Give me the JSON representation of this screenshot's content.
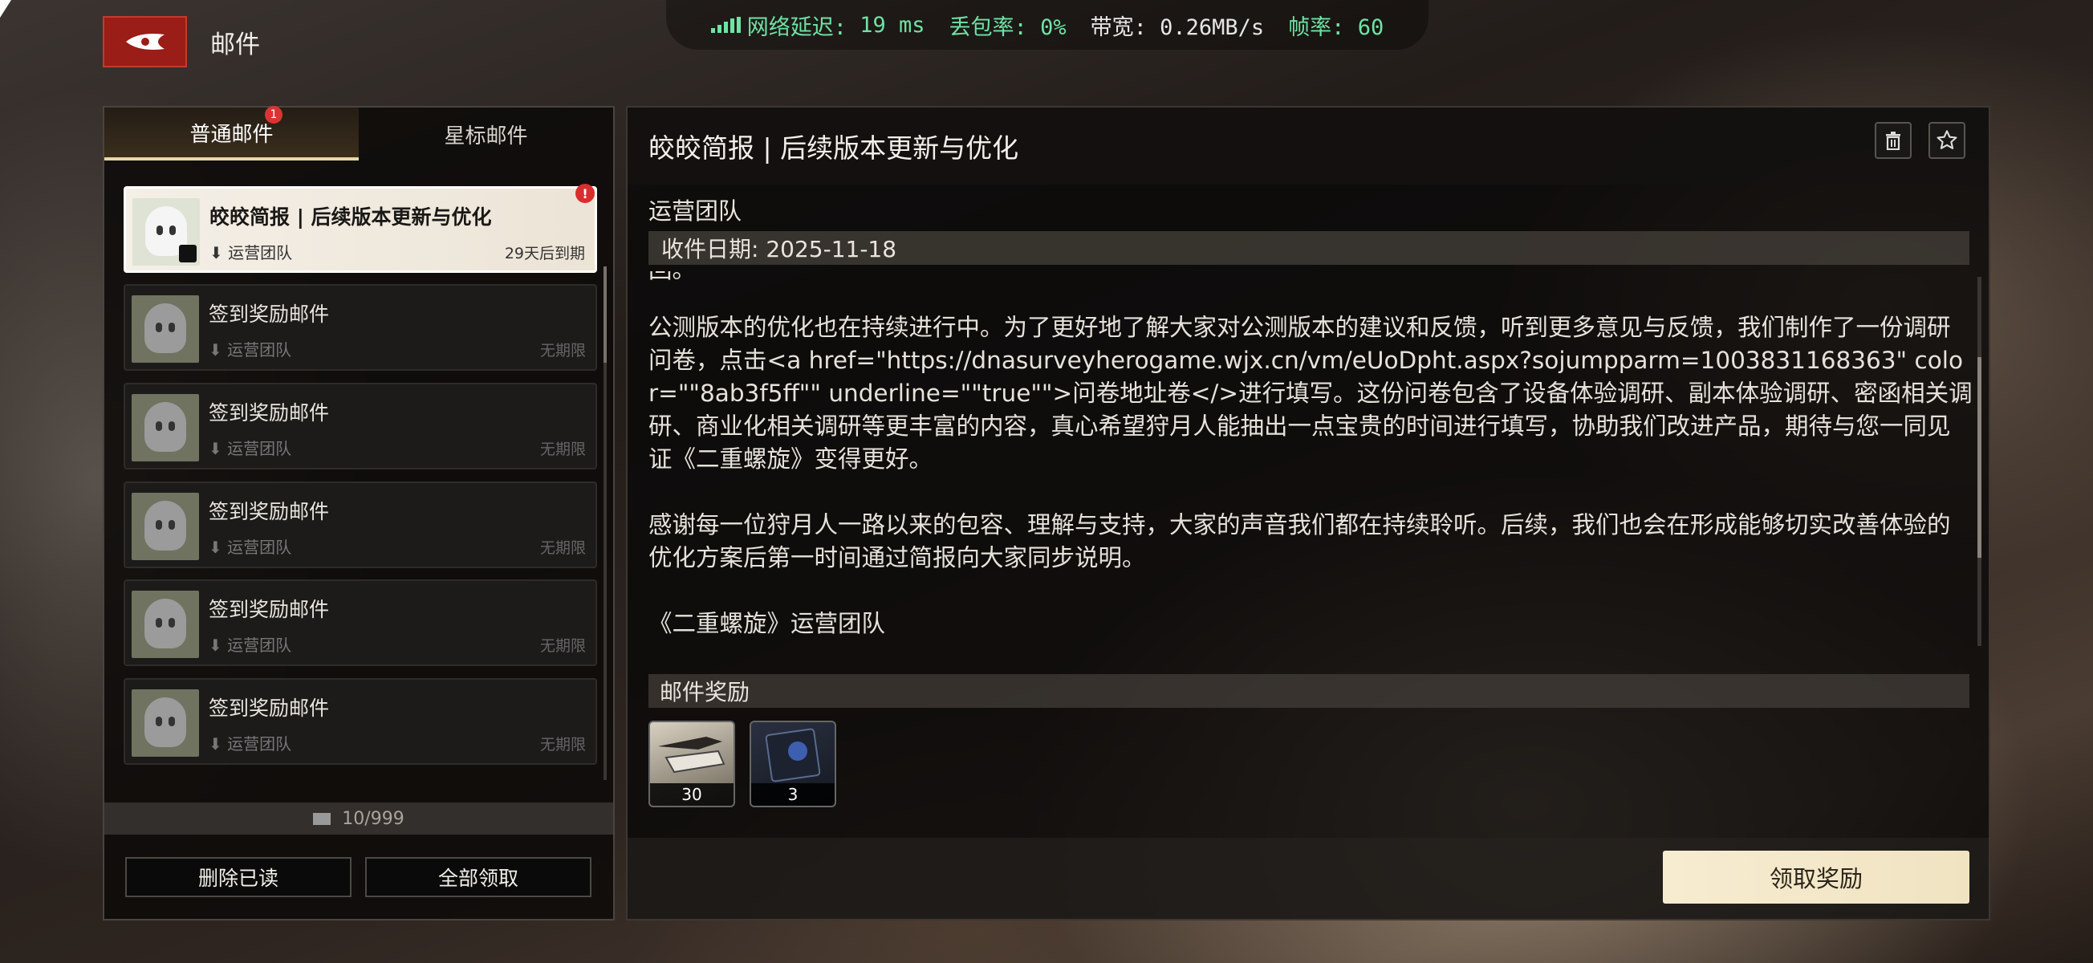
{
  "network": {
    "latency_label": "网络延迟:",
    "latency_value": "19 ms",
    "loss_label": "丢包率:",
    "loss_value": "0%",
    "bandwidth_label": "带宽:",
    "bandwidth_value": "0.26MB/s",
    "fps_label": "帧率:",
    "fps_value": "60",
    "accent_color": "#6ee3a4"
  },
  "header": {
    "back_icon": "faction-emblem-icon",
    "title": "邮件"
  },
  "tabs": [
    {
      "label": "普通邮件",
      "badge": "1",
      "active": true
    },
    {
      "label": "星标邮件",
      "active": false
    }
  ],
  "mail_list": [
    {
      "subject": "皎皎简报 | 后续版本更新与优化",
      "sender": "运营团队",
      "expiry": "29天后到期",
      "active": true,
      "alert": "!"
    },
    {
      "subject": "签到奖励邮件",
      "sender": "运营团队",
      "expiry": "无期限",
      "active": false
    },
    {
      "subject": "签到奖励邮件",
      "sender": "运营团队",
      "expiry": "无期限",
      "active": false
    },
    {
      "subject": "签到奖励邮件",
      "sender": "运营团队",
      "expiry": "无期限",
      "active": false
    },
    {
      "subject": "签到奖励邮件",
      "sender": "运营团队",
      "expiry": "无期限",
      "active": false
    },
    {
      "subject": "签到奖励邮件",
      "sender": "运营团队",
      "expiry": "无期限",
      "active": false
    }
  ],
  "mail_count": "10/999",
  "buttons": {
    "delete_read": "删除已读",
    "claim_all": "全部领取",
    "claim_reward": "领取奖励"
  },
  "detail": {
    "title": "皎皎简报 | 后续版本更新与优化",
    "sender": "运营团队",
    "received_date": "收件日期: 2025-11-18",
    "body_cut": "回。",
    "paragraphs": [
      "公测版本的优化也在持续进行中。为了更好地了解大家对公测版本的建议和反馈，听到更多意见与反馈，我们制作了一份调研问卷，点击<a href=\"https://dnasurveyherogame.wjx.cn/vm/eUoDpht.aspx?sojumpparm=1003831168363\" color=\"\"8ab3f5ff\"\" underline=\"\"true\"\">问卷地址卷</>进行填写。这份问卷包含了设备体验调研、副本体验调研、密函相关调研、商业化相关调研等更丰富的内容，真心希望狩月人能抽出一点宝贵的时间进行填写，协助我们改进产品，期待与您一同见证《二重螺旋》变得更好。",
      "感谢每一位狩月人一路以来的包容、理解与支持，大家的声音我们都在持续聆听。后续，我们也会在形成能够切实改善体验的优化方案后第一时间通过简报向大家同步说明。",
      "《二重螺旋》运营团队"
    ],
    "rewards_label": "邮件奖励",
    "rewards": [
      {
        "icon": "weapon-material-icon",
        "qty": "30"
      },
      {
        "icon": "blue-card-icon",
        "qty": "3"
      }
    ]
  }
}
